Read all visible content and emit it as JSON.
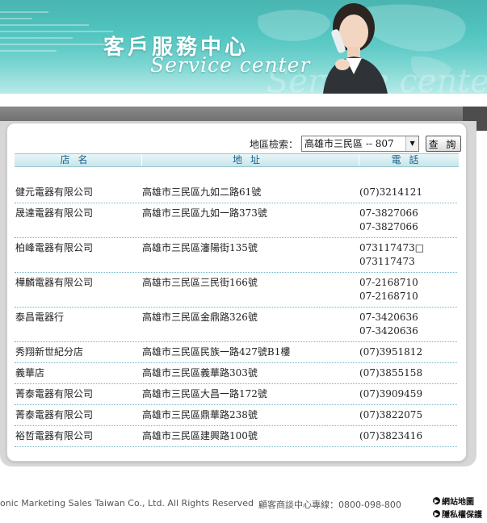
{
  "banner": {
    "title_cn": "客戶服務中心",
    "title_en": "Service center",
    "title_en_ghost": "Service center"
  },
  "search": {
    "label": "地區檢索：",
    "selected_region": "高雄市三民區 -- 807",
    "query_button": "查 詢"
  },
  "table": {
    "headers": {
      "name": "店名",
      "address": "地址",
      "phone": "電話"
    },
    "rows": [
      {
        "name": "健元電器有限公司",
        "address": "高雄市三民區九如二路61號",
        "phones": [
          "(07)3214121"
        ]
      },
      {
        "name": "晟達電器有限公司",
        "address": "高雄市三民區九如一路373號",
        "phones": [
          "07-3827066",
          "07-3827066"
        ]
      },
      {
        "name": "柏峰電器有限公司",
        "address": "高雄市三民區瀋陽街135號",
        "phones": [
          "073117473□",
          "073117473"
        ]
      },
      {
        "name": "樺麟電器有限公司",
        "address": "高雄市三民區三民街166號",
        "phones": [
          "07-2168710",
          "07-2168710"
        ]
      },
      {
        "name": "泰昌電器行",
        "address": "高雄市三民區金鼎路326號",
        "phones": [
          "07-3420636",
          "07-3420636"
        ]
      },
      {
        "name": "秀翔新世紀分店",
        "address": "高雄市三民區民族一路427號B1樓",
        "phones": [
          "(07)3951812"
        ]
      },
      {
        "name": "義華店",
        "address": "高雄市三民區義華路303號",
        "phones": [
          "(07)3855158"
        ]
      },
      {
        "name": "菁泰電器有限公司",
        "address": "高雄市三民區大昌一路172號",
        "phones": [
          "(07)3909459"
        ]
      },
      {
        "name": "菁泰電器有限公司",
        "address": "高雄市三民區鼎華路238號",
        "phones": [
          "(07)3822075"
        ]
      },
      {
        "name": "裕哲電器有限公司",
        "address": "高雄市三民區建興路100號",
        "phones": [
          "(07)3823416"
        ]
      }
    ]
  },
  "footer": {
    "copyright": "onic Marketing Sales Taiwan Co., Ltd. All Rights Reserved",
    "hotline": "顧客商談中心專線：0800-098-800",
    "links": [
      "網站地圖",
      "隱私權保護"
    ]
  },
  "colors": {
    "banner_teal": "#49c2bd",
    "header_text": "#1a5f8a",
    "row_divider": "#6fb4c9"
  }
}
